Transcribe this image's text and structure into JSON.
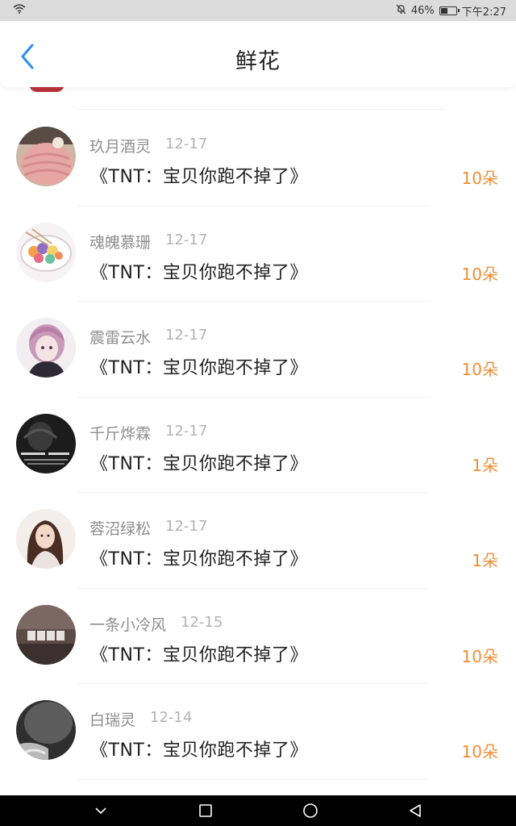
{
  "status_bar": {
    "battery_text": "46%",
    "battery_level": 0.46,
    "time": "下午2:27"
  },
  "header": {
    "title": "鲜花",
    "accent_color": "#2b8ef0"
  },
  "colors": {
    "count": "#f18d36",
    "name": "#8e8e8e",
    "date": "#b3b3b3"
  },
  "rows": [
    {
      "name": "玖月酒灵",
      "date": "12-17",
      "gift": "《TNT：宝贝你跑不掉了》",
      "count": "10朵",
      "avatar_icon": "knit-hat-avatar-icon"
    },
    {
      "name": "魂魄慕珊",
      "date": "12-17",
      "gift": "《TNT：宝贝你跑不掉了》",
      "count": "10朵",
      "avatar_icon": "food-bowl-avatar-icon"
    },
    {
      "name": "震雷云水",
      "date": "12-17",
      "gift": "《TNT：宝贝你跑不掉了》",
      "count": "10朵",
      "avatar_icon": "anime-girl-avatar-icon"
    },
    {
      "name": "千斤烨霖",
      "date": "12-17",
      "gift": "《TNT：宝贝你跑不掉了》",
      "count": "1朵",
      "avatar_icon": "dark-text-avatar-icon"
    },
    {
      "name": "蓉沼绿松",
      "date": "12-17",
      "gift": "《TNT：宝贝你跑不掉了》",
      "count": "1朵",
      "avatar_icon": "girl-photo-avatar-icon"
    },
    {
      "name": "一条小冷风",
      "date": "12-15",
      "gift": "《TNT：宝贝你跑不掉了》",
      "count": "10朵",
      "avatar_icon": "calligraphy-avatar-icon"
    },
    {
      "name": "白瑞灵",
      "date": "12-14",
      "gift": "《TNT：宝贝你跑不掉了》",
      "count": "10朵",
      "avatar_icon": "gray-photo-avatar-icon"
    }
  ]
}
